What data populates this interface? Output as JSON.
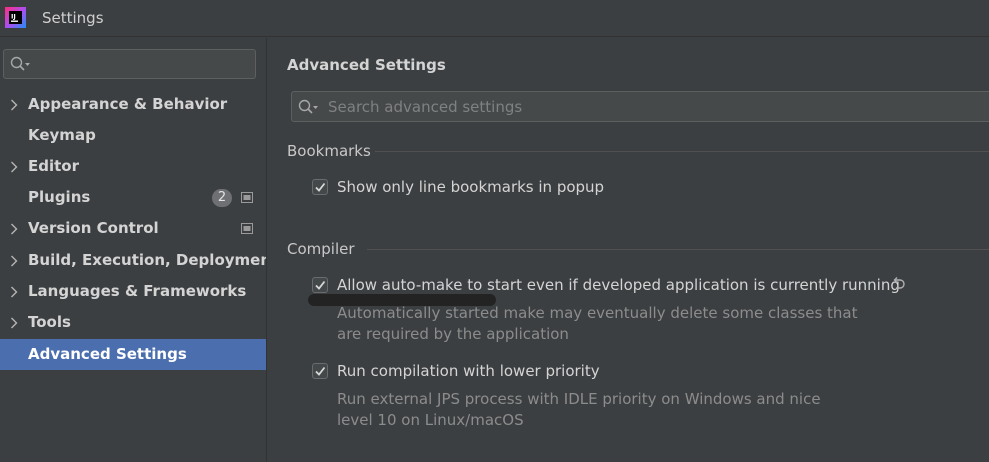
{
  "window": {
    "title": "Settings"
  },
  "sidebar": {
    "search": {
      "placeholder": ""
    },
    "items": [
      {
        "label": "Appearance & Behavior",
        "expandable": true
      },
      {
        "label": "Keymap",
        "expandable": false
      },
      {
        "label": "Editor",
        "expandable": true
      },
      {
        "label": "Plugins",
        "expandable": false,
        "badge": "2"
      },
      {
        "label": "Version Control",
        "expandable": true
      },
      {
        "label": "Build, Execution, Deployment",
        "expandable": true
      },
      {
        "label": "Languages & Frameworks",
        "expandable": true
      },
      {
        "label": "Tools",
        "expandable": true
      },
      {
        "label": "Advanced Settings",
        "expandable": false,
        "selected": true
      }
    ]
  },
  "main": {
    "title": "Advanced Settings",
    "search": {
      "placeholder": "Search advanced settings"
    },
    "sections": [
      {
        "title": "Bookmarks",
        "options": [
          {
            "label": "Show only line bookmarks in popup",
            "checked": true
          }
        ]
      },
      {
        "title": "Compiler",
        "options": [
          {
            "label": "Allow auto-make to start even if developed application is currently running",
            "checked": true,
            "desc_line1": "Automatically started make may eventually delete some classes that",
            "desc_line2": "are required by the application"
          },
          {
            "label": "Run compilation with lower priority",
            "checked": true,
            "desc_line1": "Run external JPS process with IDLE priority on Windows and nice",
            "desc_line2": "level 10 on Linux/macOS"
          }
        ]
      }
    ]
  },
  "colors": {
    "background": "#3c3f41",
    "selection": "#4b6eaf",
    "text": "#d4d4d4",
    "muted": "#8c8c8c"
  },
  "icons": [
    "app-logo-icon",
    "search-icon",
    "chevron-right-icon",
    "project-level-icon",
    "checkmark-icon",
    "reset-to-default-icon"
  ]
}
